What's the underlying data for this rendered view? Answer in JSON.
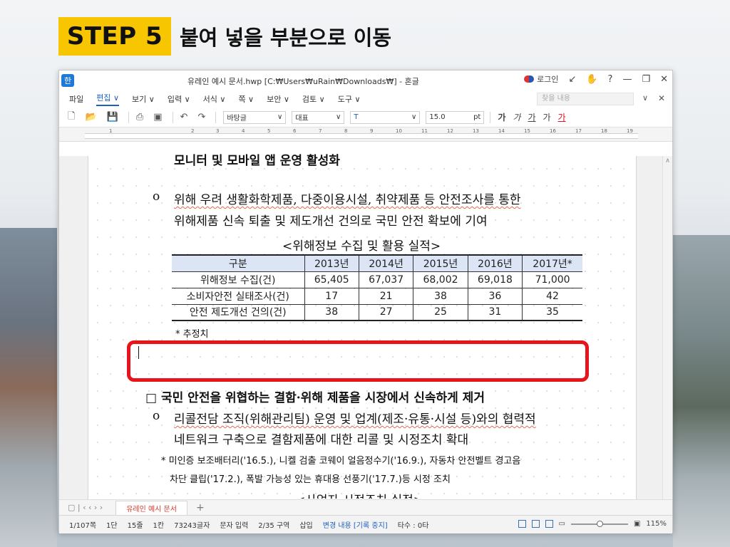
{
  "slide": {
    "step_label": "STEP 5",
    "step_title": "붙여 넣을 부분으로 이동"
  },
  "window": {
    "title": "유레인 예시 문서.hwp [C:₩Users₩uRain₩Downloads₩] - 혼글",
    "app_icon_letter": "한",
    "login_label": "로그인",
    "controls": [
      "↙",
      "✋",
      "?",
      "—",
      "❐",
      "✕"
    ]
  },
  "menu": {
    "items": [
      "파일",
      "편집 ∨",
      "보기 ∨",
      "입력 ∨",
      "서식 ∨",
      "쪽 ∨",
      "보안 ∨",
      "검토 ∨",
      "도구 ∨"
    ],
    "find_placeholder": "찾을 내용"
  },
  "toolbar": {
    "style_select": "바탕글",
    "font_lang": "대표",
    "font_name": "T",
    "font_size": "15.0",
    "size_unit": "pt",
    "format_buttons": [
      "가",
      "가",
      "가",
      "가",
      "가"
    ]
  },
  "ruler": {
    "numbers": [
      "1",
      "2",
      "3",
      "4",
      "5",
      "6",
      "7",
      "8",
      "9",
      "10",
      "11",
      "12",
      "13",
      "14",
      "15",
      "16",
      "17",
      "18",
      "19"
    ]
  },
  "document": {
    "heading_line": "모니터 및 모바일 앱 운영 활성화",
    "bullet1_line1": "위해 우려 생활화학제품, 다중이용시설, 취약제품 등 안전조사를 통한",
    "bullet1_line2": "위해제품 신속 퇴출 및 제도개선 건의로 국민 안전 확보에 기여",
    "table_caption": "<위해정보 수집 및 활용 실적>",
    "table": {
      "headers": [
        "구분",
        "2013년",
        "2014년",
        "2015년",
        "2016년",
        "2017년*"
      ],
      "rows": [
        [
          "위해정보 수집(건)",
          "65,405",
          "67,037",
          "68,002",
          "69,018",
          "71,000"
        ],
        [
          "소비자안전 실태조사(건)",
          "17",
          "21",
          "38",
          "36",
          "42"
        ],
        [
          "안전 제도개선 건의(건)",
          "38",
          "27",
          "25",
          "31",
          "35"
        ]
      ]
    },
    "footnote": "* 추정치",
    "section2_title": "□ 국민 안전을 위협하는 결함·위해 제품을 시장에서 신속하게 제거",
    "bullet2_line1": "리콜전담 조직(위해관리팀) 운영 및 업계(제조·유통·시설 등)와의 협력적",
    "bullet2_line2": "네트워크 구축으로 결함제품에 대한 리콜 및 시정조치 확대",
    "note_line1": "* 미인증 보조배터리('16.5.), 니켈 검출 코웨이 얼음정수기('16.9.), 자동차 안전벨트 경고음",
    "note_line2": "차단 클립('17.2.), 폭발 가능성 있는 휴대용 선풍기('17.7.)등 시정 조치",
    "cut_caption": "<사업자 시정조치 실적>"
  },
  "tabs": {
    "doc_tab": "유레인 예시 문서",
    "add": "+"
  },
  "status": {
    "page": "1/107쪽",
    "col": "1단",
    "line": "15줄",
    "char": "1칸",
    "count": "73243글자",
    "mode": "문자 입력",
    "section": "2/35 구역",
    "insert": "삽입",
    "track": "변경 내용 [기록 중지]",
    "typing": "타수 : 0타",
    "zoom": "115%"
  },
  "colors": {
    "step_badge": "#f7c600",
    "highlight_border": "#e8141b",
    "table_header": "#dbe5f5",
    "accent_blue": "#1e5fbf"
  }
}
